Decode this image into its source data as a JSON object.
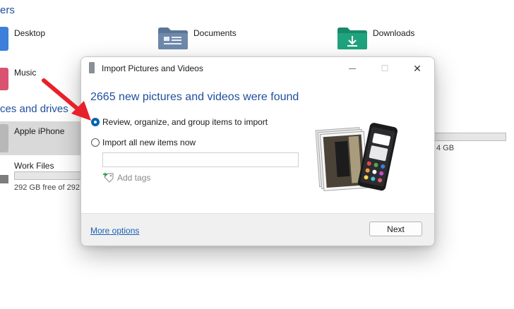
{
  "explorer": {
    "folders_heading": "ers",
    "devices_heading": "ces and drives",
    "folders": [
      {
        "label": "Desktop"
      },
      {
        "label": "Documents"
      },
      {
        "label": "Downloads"
      },
      {
        "label": "Music"
      }
    ],
    "drives": [
      {
        "label": "Apple iPhone"
      },
      {
        "label": "Work Files",
        "free": "292 GB free of 292"
      }
    ],
    "partial_free": "4 GB"
  },
  "dialog": {
    "title": "Import Pictures and Videos",
    "headline": "2665 new pictures and videos were found",
    "options": [
      {
        "label": "Review, organize, and group items to import",
        "selected": true
      },
      {
        "label": "Import all new items now",
        "selected": false
      }
    ],
    "tags_field_value": "",
    "add_tags_label": "Add tags",
    "more_options_label": "More options",
    "next_label": "Next",
    "minimize_glyph": "—",
    "maximize_glyph": "☐",
    "close_glyph": "✕"
  },
  "colors": {
    "accent": "#1f4e9e",
    "radio_selected": "#0063b1",
    "annotation_arrow": "#e8202a"
  }
}
